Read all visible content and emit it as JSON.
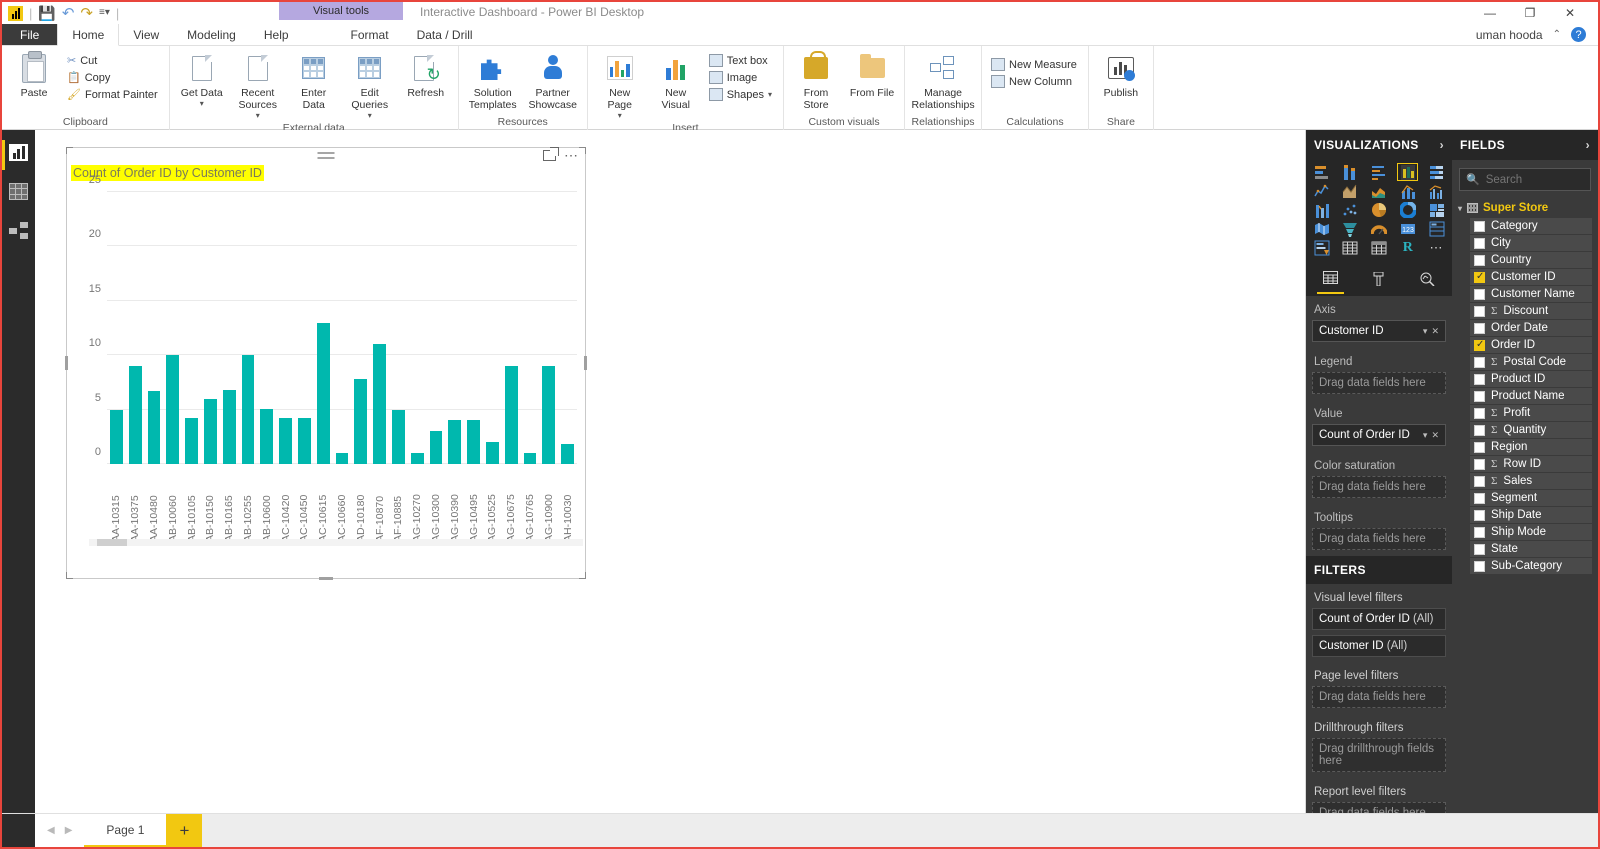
{
  "window": {
    "title": "Interactive Dashboard - Power BI Desktop",
    "contextual_tab": "Visual tools",
    "user": "uman hooda",
    "minimize": "—",
    "maximize": "❐",
    "close": "✕",
    "help_icon": "help-icon",
    "collapse_ribbon": "⌃"
  },
  "quick_access": {
    "save": "save-icon",
    "undo": "undo-icon",
    "redo": "redo-icon",
    "customize": "customize-icon"
  },
  "ribbon_tabs": [
    {
      "label": "File",
      "type": "file"
    },
    {
      "label": "Home",
      "type": "active"
    },
    {
      "label": "View",
      "type": "normal"
    },
    {
      "label": "Modeling",
      "type": "normal"
    },
    {
      "label": "Help",
      "type": "normal"
    },
    {
      "label": "Format",
      "type": "contextual"
    },
    {
      "label": "Data / Drill",
      "type": "contextual"
    }
  ],
  "ribbon": {
    "groups": [
      {
        "title": "Clipboard",
        "big": [
          {
            "label": "Paste",
            "icon": "paste-icon"
          }
        ],
        "small": [
          {
            "label": "Cut",
            "icon": "cut-icon"
          },
          {
            "label": "Copy",
            "icon": "copy-icon"
          },
          {
            "label": "Format Painter",
            "icon": "format-painter-icon"
          }
        ]
      },
      {
        "title": "External data",
        "big": [
          {
            "label": "Get Data",
            "icon": "get-data-icon",
            "caret": true
          },
          {
            "label": "Recent Sources",
            "icon": "recent-sources-icon",
            "caret": true
          },
          {
            "label": "Enter Data",
            "icon": "enter-data-icon"
          },
          {
            "label": "Edit Queries",
            "icon": "edit-queries-icon",
            "caret": true
          },
          {
            "label": "Refresh",
            "icon": "refresh-icon"
          }
        ],
        "small": []
      },
      {
        "title": "Resources",
        "big": [
          {
            "label": "Solution Templates",
            "icon": "solution-templates-icon"
          },
          {
            "label": "Partner Showcase",
            "icon": "partner-showcase-icon"
          }
        ],
        "small": []
      },
      {
        "title": "Insert",
        "big": [
          {
            "label": "New Page",
            "icon": "new-page-icon",
            "caret": true
          },
          {
            "label": "New Visual",
            "icon": "new-visual-icon"
          }
        ],
        "small": [
          {
            "label": "Text box",
            "icon": "text-box-icon"
          },
          {
            "label": "Image",
            "icon": "image-icon"
          },
          {
            "label": "Shapes",
            "icon": "shapes-icon",
            "caret": true
          }
        ]
      },
      {
        "title": "Custom visuals",
        "big": [
          {
            "label": "From Store",
            "icon": "from-store-icon"
          },
          {
            "label": "From File",
            "icon": "from-file-icon"
          }
        ],
        "small": []
      },
      {
        "title": "Relationships",
        "big": [
          {
            "label": "Manage Relationships",
            "icon": "manage-relationships-icon"
          }
        ],
        "small": []
      },
      {
        "title": "Calculations",
        "big": [],
        "small": [
          {
            "label": "New Measure",
            "icon": "new-measure-icon"
          },
          {
            "label": "New Column",
            "icon": "new-column-icon"
          }
        ]
      },
      {
        "title": "Share",
        "big": [
          {
            "label": "Publish",
            "icon": "publish-icon"
          }
        ],
        "small": []
      }
    ]
  },
  "left_rail": [
    {
      "name": "report-view",
      "icon": "report-view-icon",
      "active": true
    },
    {
      "name": "data-view",
      "icon": "data-view-icon",
      "active": false
    },
    {
      "name": "model-view",
      "icon": "model-view-icon",
      "active": false
    }
  ],
  "visual": {
    "title": "Count of Order ID by Customer ID",
    "title_highlight_color": "#ffff00",
    "focus_mode_icon": "focus-mode-icon",
    "more_options_icon": "more-options-icon",
    "drag_handle_icon": "drag-handle-icon"
  },
  "chart_data": {
    "type": "bar",
    "title": "Count of Order ID by Customer ID",
    "xlabel": "",
    "ylabel": "",
    "ylim": [
      0,
      25
    ],
    "yticks": [
      0,
      5,
      10,
      15,
      20,
      25
    ],
    "grid": true,
    "legend": "none",
    "bar_color": "#00b8ae",
    "categories": [
      "AA-10315",
      "AA-10375",
      "AA-10480",
      "AB-10060",
      "AB-10105",
      "AB-10150",
      "AB-10165",
      "AB-10255",
      "AB-10600",
      "AC-10420",
      "AC-10450",
      "AC-10615",
      "AC-10660",
      "AD-10180",
      "AF-10870",
      "AF-10885",
      "AG-10270",
      "AG-10300",
      "AG-10390",
      "AG-10495",
      "AG-10525",
      "AG-10675",
      "AG-10765",
      "AG-10900",
      "AH-10030"
    ],
    "values": [
      5,
      9,
      6.7,
      10,
      4.2,
      6,
      6.8,
      10,
      5.1,
      4.2,
      4.2,
      13,
      1,
      7.8,
      11,
      5,
      1,
      3,
      4,
      4,
      2,
      9,
      1,
      9,
      1.8
    ],
    "series": [
      {
        "name": "Count of Order ID",
        "values": [
          5,
          9,
          6.7,
          10,
          4.2,
          6,
          6.8,
          10,
          5.1,
          4.2,
          4.2,
          13,
          1,
          7.8,
          11,
          5,
          1,
          3,
          4,
          4,
          2,
          9,
          1,
          9,
          1.8
        ]
      }
    ]
  },
  "visualizations": {
    "header": "VISUALIZATIONS",
    "expand_icon": "chevron-right-icon",
    "gallery": [
      [
        {
          "name": "stacked-bar-chart-icon"
        },
        {
          "name": "stacked-column-chart-icon"
        },
        {
          "name": "clustered-bar-chart-icon"
        },
        {
          "name": "clustered-column-chart-icon",
          "selected": true
        },
        {
          "name": "100-percent-stacked-bar-chart-icon"
        }
      ],
      [
        {
          "name": "line-chart-icon"
        },
        {
          "name": "area-chart-icon"
        },
        {
          "name": "stacked-area-chart-icon"
        },
        {
          "name": "line-stacked-column-chart-icon"
        },
        {
          "name": "line-clustered-column-chart-icon"
        }
      ],
      [
        {
          "name": "ribbon-chart-icon"
        },
        {
          "name": "scatter-chart-icon"
        },
        {
          "name": "pie-chart-icon"
        },
        {
          "name": "donut-chart-icon"
        },
        {
          "name": "treemap-icon"
        }
      ],
      [
        {
          "name": "map-icon"
        },
        {
          "name": "funnel-chart-icon"
        },
        {
          "name": "gauge-icon"
        },
        {
          "name": "card-icon"
        },
        {
          "name": "multi-row-card-icon"
        }
      ],
      [
        {
          "name": "slicer-icon"
        },
        {
          "name": "table-icon"
        },
        {
          "name": "matrix-icon"
        },
        {
          "name": "r-script-visual-icon"
        },
        {
          "name": "more-visuals-icon"
        }
      ]
    ],
    "tabs": [
      {
        "name": "fields-tab-icon",
        "active": true
      },
      {
        "name": "format-tab-icon",
        "active": false
      },
      {
        "name": "analytics-tab-icon",
        "active": false
      }
    ],
    "wells": [
      {
        "label": "Axis",
        "value": "Customer ID",
        "filled": true,
        "placeholder": "Drag data fields here"
      },
      {
        "label": "Legend",
        "value": "",
        "filled": false,
        "placeholder": "Drag data fields here"
      },
      {
        "label": "Value",
        "value": "Count of Order ID",
        "filled": true,
        "placeholder": "Drag data fields here"
      },
      {
        "label": "Color saturation",
        "value": "",
        "filled": false,
        "placeholder": "Drag data fields here"
      },
      {
        "label": "Tooltips",
        "value": "",
        "filled": false,
        "placeholder": "Drag data fields here"
      }
    ]
  },
  "filters": {
    "header": "FILTERS",
    "sections": [
      {
        "label": "Visual level filters",
        "cards": [
          {
            "field": "Count of Order ID",
            "scope": "(All)"
          },
          {
            "field": "Customer ID",
            "scope": "(All)"
          }
        ],
        "placeholder": ""
      },
      {
        "label": "Page level filters",
        "cards": [],
        "placeholder": "Drag data fields here"
      },
      {
        "label": "Drillthrough filters",
        "cards": [],
        "placeholder": "Drag drillthrough fields here"
      },
      {
        "label": "Report level filters",
        "cards": [],
        "placeholder": "Drag data fields here"
      }
    ]
  },
  "fields": {
    "header": "FIELDS",
    "expand_icon": "chevron-right-icon",
    "search_placeholder": "Search",
    "search_icon": "search-icon",
    "table": "Super Store",
    "items": [
      {
        "label": "Category",
        "checked": false,
        "aggregate": false
      },
      {
        "label": "City",
        "checked": false,
        "aggregate": false
      },
      {
        "label": "Country",
        "checked": false,
        "aggregate": false
      },
      {
        "label": "Customer ID",
        "checked": true,
        "aggregate": false
      },
      {
        "label": "Customer Name",
        "checked": false,
        "aggregate": false
      },
      {
        "label": "Discount",
        "checked": false,
        "aggregate": true
      },
      {
        "label": "Order Date",
        "checked": false,
        "aggregate": false
      },
      {
        "label": "Order ID",
        "checked": true,
        "aggregate": false
      },
      {
        "label": "Postal Code",
        "checked": false,
        "aggregate": true
      },
      {
        "label": "Product ID",
        "checked": false,
        "aggregate": false
      },
      {
        "label": "Product Name",
        "checked": false,
        "aggregate": false
      },
      {
        "label": "Profit",
        "checked": false,
        "aggregate": true
      },
      {
        "label": "Quantity",
        "checked": false,
        "aggregate": true
      },
      {
        "label": "Region",
        "checked": false,
        "aggregate": false
      },
      {
        "label": "Row ID",
        "checked": false,
        "aggregate": true
      },
      {
        "label": "Sales",
        "checked": false,
        "aggregate": true
      },
      {
        "label": "Segment",
        "checked": false,
        "aggregate": false
      },
      {
        "label": "Ship Date",
        "checked": false,
        "aggregate": false
      },
      {
        "label": "Ship Mode",
        "checked": false,
        "aggregate": false
      },
      {
        "label": "State",
        "checked": false,
        "aggregate": false
      },
      {
        "label": "Sub-Category",
        "checked": false,
        "aggregate": false
      }
    ]
  },
  "statusbar": {
    "prev_page_icon": "prev-page-icon",
    "next_page_icon": "next-page-icon",
    "pages": [
      {
        "label": "Page 1",
        "active": true
      }
    ],
    "add_page_label": "+"
  }
}
